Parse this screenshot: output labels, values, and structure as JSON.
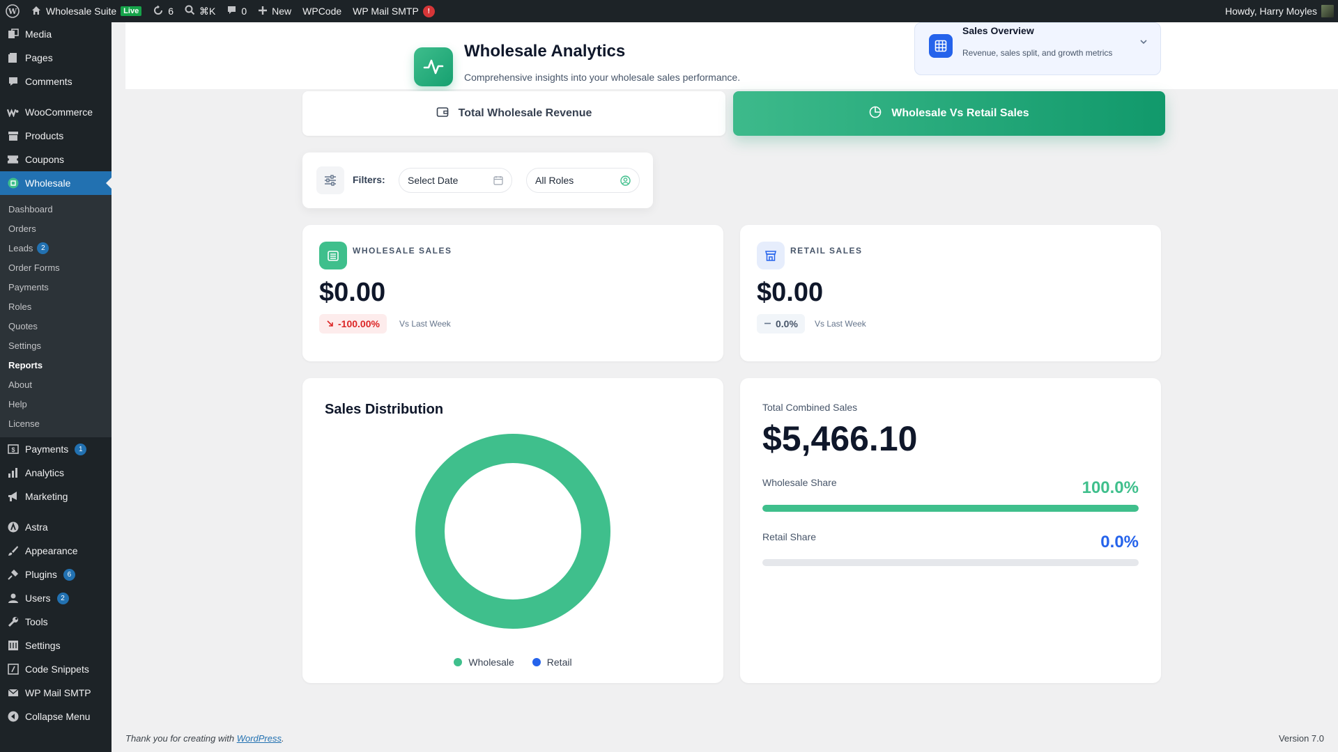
{
  "adminbar": {
    "site_name": "Wholesale Suite",
    "live_badge": "Live",
    "updates_count": "6",
    "shortcut": "⌘K",
    "comments_count": "0",
    "new_label": "New",
    "wpcode_label": "WPCode",
    "smtp_label": "WP Mail SMTP",
    "smtp_alert": "!",
    "howdy": "Howdy, Harry Moyles"
  },
  "sidebar": {
    "items_top": [
      {
        "label": "Media",
        "icon": "media-icon"
      },
      {
        "label": "Pages",
        "icon": "pages-icon"
      },
      {
        "label": "Comments",
        "icon": "comments-icon"
      }
    ],
    "items_shop": [
      {
        "label": "WooCommerce",
        "icon": "woocommerce-icon"
      },
      {
        "label": "Products",
        "icon": "products-icon"
      },
      {
        "label": "Coupons",
        "icon": "coupons-icon"
      }
    ],
    "current": {
      "label": "Wholesale",
      "icon": "wholesale-icon"
    },
    "submenu": [
      {
        "label": "Dashboard"
      },
      {
        "label": "Orders"
      },
      {
        "label": "Leads",
        "badge": "2"
      },
      {
        "label": "Order Forms"
      },
      {
        "label": "Payments"
      },
      {
        "label": "Roles"
      },
      {
        "label": "Quotes"
      },
      {
        "label": "Settings"
      },
      {
        "label": "Reports",
        "active": true
      },
      {
        "label": "About"
      },
      {
        "label": "Help"
      },
      {
        "label": "License"
      }
    ],
    "items_mid": [
      {
        "label": "Payments",
        "icon": "payments-icon",
        "badge": "1"
      },
      {
        "label": "Analytics",
        "icon": "analytics-icon"
      },
      {
        "label": "Marketing",
        "icon": "marketing-icon"
      }
    ],
    "items_bottom": [
      {
        "label": "Astra",
        "icon": "astra-icon"
      },
      {
        "label": "Appearance",
        "icon": "appearance-icon"
      },
      {
        "label": "Plugins",
        "icon": "plugins-icon",
        "badge": "6"
      },
      {
        "label": "Users",
        "icon": "users-icon",
        "badge": "2"
      },
      {
        "label": "Tools",
        "icon": "tools-icon"
      },
      {
        "label": "Settings",
        "icon": "settings-icon"
      },
      {
        "label": "Code Snippets",
        "icon": "code-snippets-icon"
      },
      {
        "label": "WP Mail SMTP",
        "icon": "mail-icon"
      },
      {
        "label": "Collapse Menu",
        "icon": "collapse-icon"
      }
    ]
  },
  "header": {
    "title": "Wholesale Analytics",
    "subtitle": "Comprehensive insights into your wholesale sales performance."
  },
  "overview": {
    "title": "Sales Overview",
    "subtitle": "Revenue, sales split, and growth metrics"
  },
  "tabs": {
    "revenue": "Total Wholesale Revenue",
    "vs_retail": "Wholesale Vs Retail Sales"
  },
  "filters": {
    "label": "Filters:",
    "date": "Select Date",
    "roles": "All Roles"
  },
  "stats": {
    "wholesale": {
      "label": "WHOLESALE SALES",
      "value": "$0.00",
      "change": "-100.00%",
      "vs": "Vs Last Week"
    },
    "retail": {
      "label": "RETAIL SALES",
      "value": "$0.00",
      "change": "0.0%",
      "vs": "Vs Last Week"
    }
  },
  "distribution": {
    "title": "Sales Distribution",
    "legend": {
      "wholesale": "Wholesale",
      "retail": "Retail"
    }
  },
  "combined": {
    "label": "Total Combined Sales",
    "value": "$5,466.10",
    "wholesale_label": "Wholesale Share",
    "wholesale_pct": "100.0%",
    "retail_label": "Retail Share",
    "retail_pct": "0.0%"
  },
  "chart_data": {
    "type": "pie",
    "title": "Sales Distribution",
    "categories": [
      "Wholesale",
      "Retail"
    ],
    "values": [
      100.0,
      0.0
    ]
  },
  "colors": {
    "wholesale": "#3fbf8c",
    "retail": "#2563eb",
    "accent": "#11996b"
  },
  "footer": {
    "thanks_prefix": "Thank you for creating with",
    "wp_link": "WordPress",
    "thanks_suffix": ".",
    "version": "Version 7.0"
  }
}
